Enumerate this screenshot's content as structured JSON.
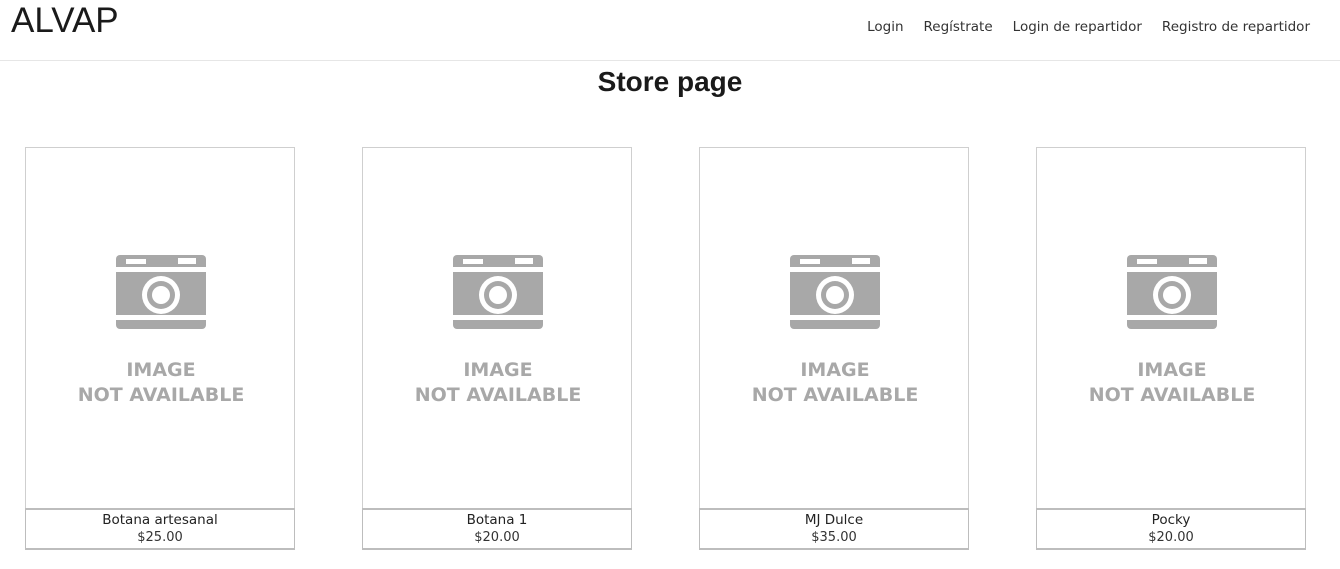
{
  "header": {
    "brand": "ALVAP",
    "nav": [
      "Login",
      "Regístrate",
      "Login de repartidor",
      "Registro de repartidor"
    ]
  },
  "page": {
    "title": "Store page"
  },
  "placeholder": {
    "line1": "IMAGE",
    "line2": "NOT AVAILABLE",
    "icon": "camera-icon"
  },
  "products": [
    {
      "name": "Botana artesanal",
      "price": "$25.00"
    },
    {
      "name": "Botana 1",
      "price": "$20.00"
    },
    {
      "name": "MJ Dulce",
      "price": "$35.00"
    },
    {
      "name": "Pocky",
      "price": "$20.00"
    }
  ],
  "colors": {
    "placeholder_gray": "#a8a8a8",
    "border": "#cfcfcf"
  }
}
